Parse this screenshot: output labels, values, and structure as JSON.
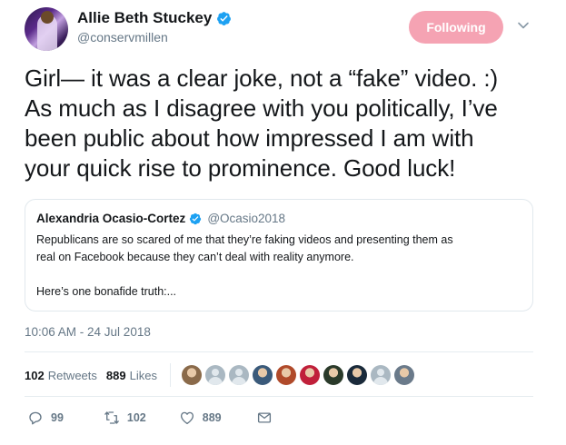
{
  "author": {
    "display_name": "Allie Beth Stuckey",
    "handle": "@conservmillen",
    "verified": true
  },
  "follow_button": {
    "label": "Following",
    "color": "#f5a3b3"
  },
  "tweet": {
    "lines": [
      "Girl— it was a clear joke, not a “fake” video. :)",
      "As much as I disagree with you politically, I’ve",
      "been public about how impressed I am with",
      "your quick rise to prominence. Good luck!"
    ],
    "timestamp": "10:06 AM - 24 Jul 2018"
  },
  "quoted_tweet": {
    "display_name": "Alexandria Ocasio-Cortez",
    "handle": "@Ocasio2018",
    "verified": true,
    "lines": [
      "Republicans are so scared of me that they’re faking videos and presenting them as",
      "real on Facebook because they can’t deal with reality anymore.",
      "",
      "Here’s one bonafide truth:..."
    ]
  },
  "stats": {
    "retweets_count": "102",
    "retweets_label": "Retweets",
    "likes_count": "889",
    "likes_label": "Likes",
    "likers": [
      {
        "type": "photo",
        "color": "#8a6a4a"
      },
      {
        "type": "default"
      },
      {
        "type": "default"
      },
      {
        "type": "photo",
        "color": "#3a5a7a"
      },
      {
        "type": "photo",
        "color": "#b04a2a"
      },
      {
        "type": "photo",
        "color": "#c0203a"
      },
      {
        "type": "photo",
        "color": "#2a3a2a"
      },
      {
        "type": "photo",
        "color": "#1a2a3a"
      },
      {
        "type": "default"
      },
      {
        "type": "photo",
        "color": "#6a7a8a"
      }
    ]
  },
  "actions": {
    "reply_count": "99",
    "retweet_count": "102",
    "like_count": "889"
  },
  "colors": {
    "verified": "#1da1f2",
    "secondary_text": "#657786",
    "border": "#e1e8ed"
  }
}
